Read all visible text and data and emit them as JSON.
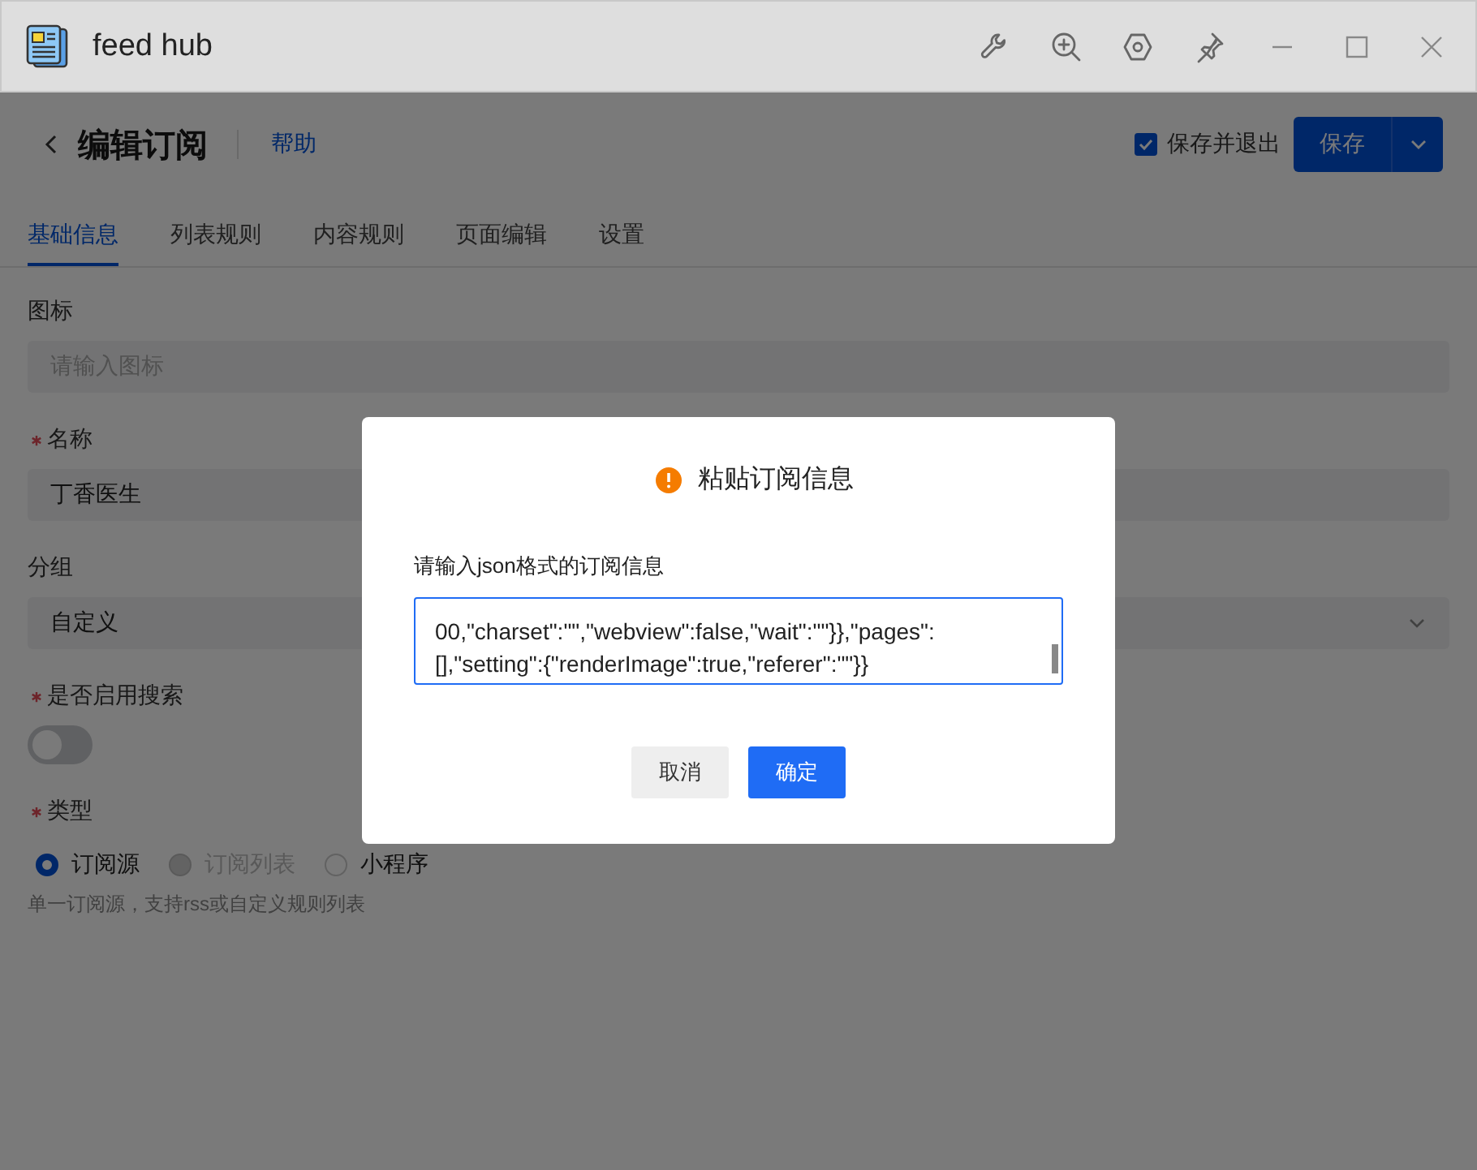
{
  "window": {
    "title": "feed hub"
  },
  "header": {
    "title": "编辑订阅",
    "help_link": "帮助",
    "save_and_exit": {
      "label": "保存并退出",
      "checked": true
    },
    "save_button": "保存"
  },
  "tabs": [
    {
      "label": "基础信息",
      "selected": true
    },
    {
      "label": "列表规则",
      "selected": false
    },
    {
      "label": "内容规则",
      "selected": false
    },
    {
      "label": "页面编辑",
      "selected": false
    },
    {
      "label": "设置",
      "selected": false
    }
  ],
  "form": {
    "fields": [
      {
        "kind": "input",
        "label": "图标",
        "required": false,
        "placeholder": "请输入图标"
      },
      {
        "kind": "input",
        "label": "名称",
        "required": true,
        "value": "丁香医生"
      },
      {
        "kind": "select",
        "label": "分组",
        "required": false,
        "value": "自定义"
      },
      {
        "kind": "switch",
        "label": "是否启用搜索",
        "required": true,
        "on": false
      },
      {
        "kind": "radio",
        "label": "类型",
        "required": true,
        "options": [
          {
            "label": "订阅源",
            "selected": true,
            "disabled": false
          },
          {
            "label": "订阅列表",
            "selected": false,
            "disabled": true
          },
          {
            "label": "小程序",
            "selected": false,
            "disabled": false
          }
        ],
        "hint": "单一订阅源，支持rss或自定义规则列表"
      }
    ]
  },
  "dialog": {
    "title": "粘贴订阅信息",
    "prompt": "请输入json格式的订阅信息",
    "value": "00,\"charset\":\"\",\"webview\":false,\"wait\":\"\"}},\"pages\":\n[],\"setting\":{\"renderImage\":true,\"referer\":\"\"}}",
    "buttons": [
      {
        "label": "取消",
        "kind": "secondary"
      },
      {
        "label": "确定",
        "kind": "primary"
      }
    ]
  }
}
